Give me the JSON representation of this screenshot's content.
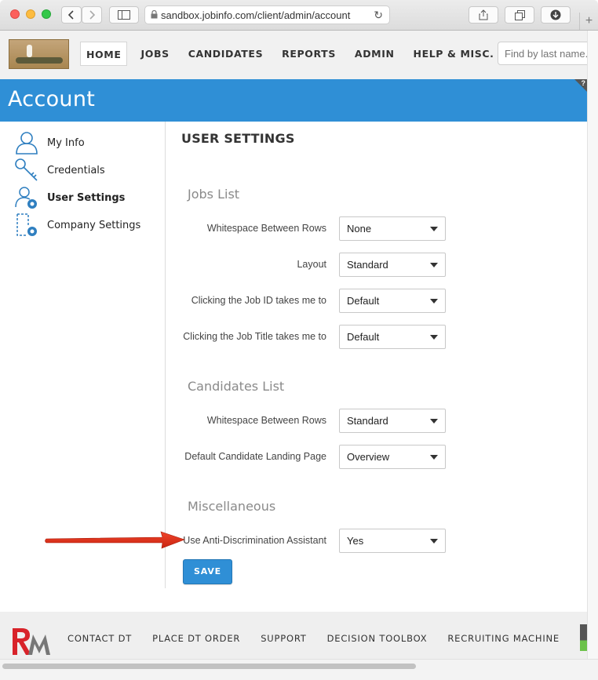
{
  "browser": {
    "url": "sandbox.jobinfo.com/client/admin/account",
    "back_icon": "chevron-left-icon",
    "forward_icon": "chevron-right-icon",
    "new_tab": "+"
  },
  "header": {
    "nav": [
      "HOME",
      "JOBS",
      "CANDIDATES",
      "REPORTS",
      "ADMIN",
      "HELP & MISC."
    ],
    "active_nav": "HOME",
    "search_placeholder": "Find by last name..."
  },
  "page": {
    "title": "Account",
    "help_badge": "?"
  },
  "sidebar": {
    "items": [
      {
        "label": "My Info",
        "icon": "user-icon"
      },
      {
        "label": "Credentials",
        "icon": "key-icon"
      },
      {
        "label": "User Settings",
        "icon": "user-gear-icon"
      },
      {
        "label": "Company Settings",
        "icon": "document-gear-icon"
      }
    ],
    "active": "User Settings"
  },
  "settings": {
    "title": "USER SETTINGS",
    "sections": [
      {
        "title": "Jobs List",
        "rows": [
          {
            "label": "Whitespace Between Rows",
            "value": "None"
          },
          {
            "label": "Layout",
            "value": "Standard"
          },
          {
            "label": "Clicking the Job ID takes me to",
            "value": "Default"
          },
          {
            "label": "Clicking the Job Title takes me to",
            "value": "Default"
          }
        ]
      },
      {
        "title": "Candidates List",
        "rows": [
          {
            "label": "Whitespace Between Rows",
            "value": "Standard"
          },
          {
            "label": "Default Candidate Landing Page",
            "value": "Overview"
          }
        ]
      },
      {
        "title": "Miscellaneous",
        "rows": [
          {
            "label": "Use Anti-Discrimination Assistant",
            "value": "Yes"
          }
        ]
      }
    ],
    "save_label": "SAVE"
  },
  "footer": {
    "nav": [
      "CONTACT DT",
      "PLACE DT ORDER",
      "SUPPORT",
      "DECISION TOOLBOX",
      "RECRUITING MACHINE"
    ],
    "logo_text": "RM"
  },
  "colors": {
    "accent": "#2f8fd6",
    "annotation_arrow": "#e8331e"
  }
}
